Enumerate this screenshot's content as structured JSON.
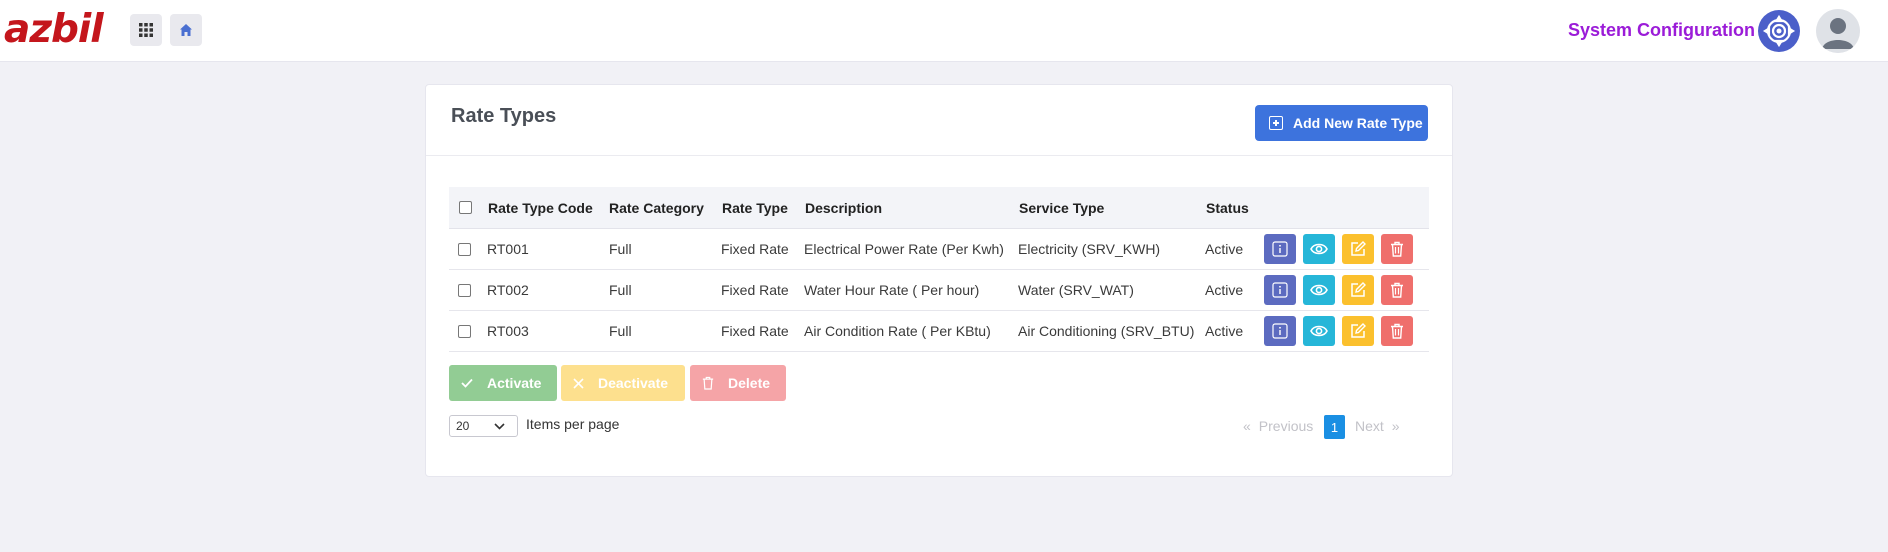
{
  "header": {
    "logo_text": "azbil",
    "title": "System Configuration",
    "brand_color": "#c4161c",
    "title_color": "#9b1cd8",
    "apps_icon": "grid-icon",
    "home_icon": "home-icon",
    "settings_icon": "gear-icon",
    "avatar_icon": "user-avatar"
  },
  "page": {
    "title": "Rate Types",
    "add_button_label": "Add New Rate Type"
  },
  "table": {
    "columns": [
      "Rate Type Code",
      "Rate Category",
      "Rate Type",
      "Description",
      "Service Type",
      "Status"
    ],
    "rows": [
      {
        "code": "RT001",
        "category": "Full",
        "type": "Fixed Rate",
        "description": "Electrical Power Rate (Per Kwh)",
        "service": "Electricity (SRV_KWH)",
        "status": "Active"
      },
      {
        "code": "RT002",
        "category": "Full",
        "type": "Fixed Rate",
        "description": "Water Hour Rate ( Per hour)",
        "service": "Water (SRV_WAT)",
        "status": "Active"
      },
      {
        "code": "RT003",
        "category": "Full",
        "type": "Fixed Rate",
        "description": "Air Condition Rate ( Per KBtu)",
        "service": "Air Conditioning (SRV_BTU)",
        "status": "Active"
      }
    ],
    "row_actions": [
      "info-icon",
      "eye-icon",
      "edit-icon",
      "trash-icon"
    ]
  },
  "bulk_actions": {
    "activate": "Activate",
    "deactivate": "Deactivate",
    "delete": "Delete"
  },
  "pagination": {
    "per_page_value": "20",
    "per_page_label": "Items per page",
    "prev_label": "Previous",
    "next_label": "Next",
    "current_page": "1"
  }
}
